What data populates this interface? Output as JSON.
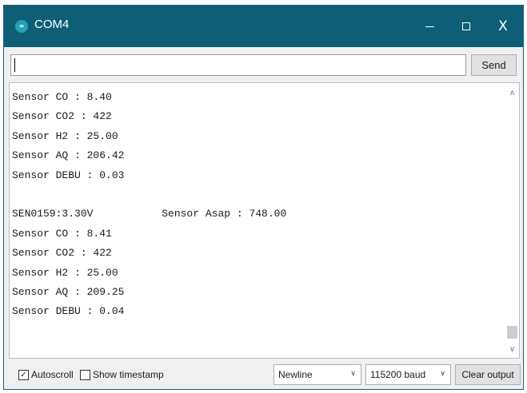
{
  "window": {
    "title": "COM4",
    "app_icon_glyph": "∞",
    "app_icon": "arduino-icon",
    "minimize_icon": "minimize-icon",
    "maximize_icon": "maximize-icon",
    "close_glyph": "X",
    "close_icon": "close-icon",
    "titlebar_color": "#0f5e78"
  },
  "send": {
    "input_value": "",
    "button_label": "Send"
  },
  "output": {
    "lines": [
      "Sensor CO : 8.40",
      "Sensor CO2 : 422",
      "Sensor H2 : 25.00",
      "Sensor AQ : 206.42",
      "Sensor DEBU : 0.03",
      "",
      "SEN0159:3.30V           Sensor Asap : 748.00",
      "Sensor CO : 8.41",
      "Sensor CO2 : 422",
      "Sensor H2 : 25.00",
      "Sensor AQ : 209.25",
      "Sensor DEBU : 0.04"
    ],
    "scroll_up_glyph": "∧",
    "scroll_down_glyph": "∨"
  },
  "footer": {
    "autoscroll_label": "Autoscroll",
    "autoscroll_checked": true,
    "autoscroll_mark": "✓",
    "timestamp_label": "Show timestamp",
    "timestamp_checked": false,
    "line_ending": "Newline",
    "baud_rate": "115200 baud",
    "chevron_glyph": "∨",
    "clear_label": "Clear output"
  }
}
